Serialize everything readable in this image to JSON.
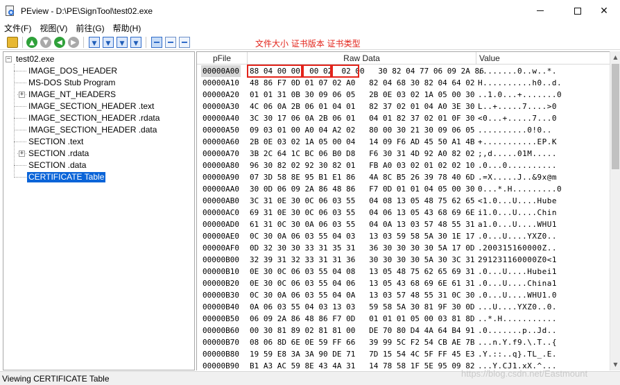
{
  "window": {
    "title": "PEview - D:\\PE\\SignTool\\test02.exe",
    "min_glyph": "",
    "close_glyph": "✕"
  },
  "menu": [
    "文件(F)",
    "视图(V)",
    "前往(G)",
    "帮助(H)"
  ],
  "toolbar": {
    "icons": [
      "open-folder-icon",
      "go-up-icon",
      "go-down-icon",
      "back-icon",
      "forward-icon",
      "view-hex-icon",
      "view-byte-icon",
      "view-word-icon",
      "view-dword-icon",
      "list-view-icon",
      "byte-view-icon",
      "word-view-icon"
    ],
    "colors": {
      "green": "#2fa13a",
      "gray": "#a9a9a9",
      "blue": "#2f6bc9"
    }
  },
  "annotation": "文件大小 证书版本 证书类型",
  "annotation_color": "#e2231a",
  "tree": {
    "root": "test02.exe",
    "items": [
      "IMAGE_DOS_HEADER",
      "MS-DOS Stub Program",
      "IMAGE_NT_HEADERS",
      "IMAGE_SECTION_HEADER .text",
      "IMAGE_SECTION_HEADER .rdata",
      "IMAGE_SECTION_HEADER .data",
      "SECTION .text",
      "SECTION .rdata",
      "SECTION .data",
      "CERTIFICATE Table"
    ],
    "expandable": [
      false,
      false,
      true,
      false,
      false,
      false,
      false,
      true,
      false,
      false
    ],
    "selected_index": 9,
    "selection_color": "#0a64d8"
  },
  "hex": {
    "columns": {
      "pfile": "pFile",
      "raw": "Raw Data",
      "value": "Value"
    },
    "rows": [
      {
        "pfile": "00000A00",
        "raw": "88 04 00 00  00 02  02 00   30 82 04 77 06 09 2A 86",
        "value": "........0..w..*."
      },
      {
        "pfile": "00000A10",
        "raw": "48 86 F7 0D 01 07 02 A0   82 04 68 30 82 04 64 02",
        "value": "H..........h0..d."
      },
      {
        "pfile": "00000A20",
        "raw": "01 01 31 0B 30 09 06 05   2B 0E 03 02 1A 05 00 30",
        "value": "..1.0...+.......0"
      },
      {
        "pfile": "00000A30",
        "raw": "4C 06 0A 2B 06 01 04 01   82 37 02 01 04 A0 3E 30",
        "value": "L..+.....7....>0"
      },
      {
        "pfile": "00000A40",
        "raw": "3C 30 17 06 0A 2B 06 01   04 01 82 37 02 01 0F 30",
        "value": "<0...+.....7...0"
      },
      {
        "pfile": "00000A50",
        "raw": "09 03 01 00 A0 04 A2 02   80 00 30 21 30 09 06 05",
        "value": "..........0!0.."
      },
      {
        "pfile": "00000A60",
        "raw": "2B 0E 03 02 1A 05 00 04   14 09 F6 AD 45 50 A1 4B",
        "value": "+...........EP.K"
      },
      {
        "pfile": "00000A70",
        "raw": "3B 2C 64 1C BC 06 B0 D8   F6 30 31 4D 92 A0 82 02",
        "value": ";,d.....01M....."
      },
      {
        "pfile": "00000A80",
        "raw": "96 30 82 02 92 30 82 01   FB A0 03 02 01 02 02 10",
        "value": ".0...0.........."
      },
      {
        "pfile": "00000A90",
        "raw": "07 3D 58 8E 95 B1 E1 86   4A 8C B5 26 39 78 40 6D",
        "value": ".=X.....J..&9x@m"
      },
      {
        "pfile": "00000AA0",
        "raw": "30 0D 06 09 2A 86 48 86   F7 0D 01 01 04 05 00 30",
        "value": "0...*.H.........0"
      },
      {
        "pfile": "00000AB0",
        "raw": "3C 31 0E 30 0C 06 03 55   04 08 13 05 48 75 62 65",
        "value": "<1.0...U....Hube"
      },
      {
        "pfile": "00000AC0",
        "raw": "69 31 0E 30 0C 06 03 55   04 06 13 05 43 68 69 6E",
        "value": "i1.0...U....Chin"
      },
      {
        "pfile": "00000AD0",
        "raw": "61 31 0C 30 0A 06 03 55   04 0A 13 03 57 48 55 31",
        "value": "a1.0...U....WHU1"
      },
      {
        "pfile": "00000AE0",
        "raw": "0C 30 0A 06 03 55 04 03   13 03 59 58 5A 30 1E 17",
        "value": ".0...U....YXZ0.."
      },
      {
        "pfile": "00000AF0",
        "raw": "0D 32 30 30 33 31 35 31   36 30 30 30 30 5A 17 0D",
        "value": ".200315160000Z.."
      },
      {
        "pfile": "00000B00",
        "raw": "32 39 31 32 33 31 31 36   30 30 30 30 5A 30 3C 31",
        "value": "291231160000Z0<1"
      },
      {
        "pfile": "00000B10",
        "raw": "0E 30 0C 06 03 55 04 08   13 05 48 75 62 65 69 31",
        "value": ".0...U....Hubei1"
      },
      {
        "pfile": "00000B20",
        "raw": "0E 30 0C 06 03 55 04 06   13 05 43 68 69 6E 61 31",
        "value": ".0...U....China1"
      },
      {
        "pfile": "00000B30",
        "raw": "0C 30 0A 06 03 55 04 0A   13 03 57 48 55 31 0C 30",
        "value": ".0...U....WHU1.0"
      },
      {
        "pfile": "00000B40",
        "raw": "0A 06 03 55 04 03 13 03   59 58 5A 30 81 9F 30 0D",
        "value": "...U....YXZ0..0."
      },
      {
        "pfile": "00000B50",
        "raw": "06 09 2A 86 48 86 F7 0D   01 01 01 05 00 03 81 8D",
        "value": "..*.H..........."
      },
      {
        "pfile": "00000B60",
        "raw": "00 30 81 89 02 81 81 00   DE 70 80 D4 4A 64 B4 91",
        "value": ".0.......p..Jd.."
      },
      {
        "pfile": "00000B70",
        "raw": "08 06 8D 6E 0E 59 FF 66   39 99 5C F2 54 CB AE 7B",
        "value": "...n.Y.f9.\\.T..{"
      },
      {
        "pfile": "00000B80",
        "raw": "19 59 E8 3A 3A 90 DE 71   7D 15 54 4C 5F FF 45 E3",
        "value": ".Y.::..q}.TL_.E."
      },
      {
        "pfile": "00000B90",
        "raw": "B1 A3 AC 59 8E 43 4A 31   14 78 58 1F 5E 95 09 82",
        "value": "...Y.CJ1.xX.^..."
      }
    ]
  },
  "status": "Viewing CERTIFICATE Table",
  "watermark": "https://blog.csdn.net/Eastmount"
}
